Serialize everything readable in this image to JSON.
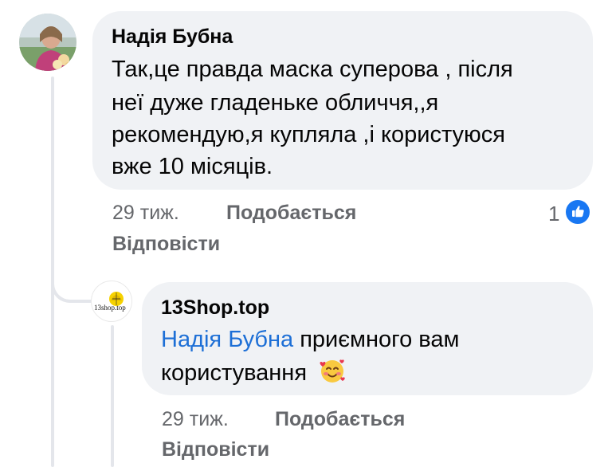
{
  "comment": {
    "author": "Надія Бубна",
    "lines": [
      "Так,це правда маска суперова , після",
      "неї дуже гладеньке обличчя,,я",
      "рекомендую,я купляла ,і користуюся",
      "вже 10 місяців."
    ],
    "time": "29 тиж.",
    "like_label": "Подобається",
    "reply_label": "Відповісти",
    "reaction_count": "1",
    "reaction_icon": "thumbs-up-icon"
  },
  "reply": {
    "author": "13Shop.top",
    "avatar_text": "13shop.top",
    "mention": "Надія Бубна",
    "text_after_mention": " приємного вам",
    "line2": "користування",
    "emoji": "smiling-face-with-hearts",
    "time": "29 тиж.",
    "like_label": "Подобається",
    "reply_label": "Відповісти"
  },
  "colors": {
    "bubble": "#f0f2f5",
    "meta": "#65676b",
    "link": "#1d6fd6",
    "like_badge": "#1877f2"
  }
}
